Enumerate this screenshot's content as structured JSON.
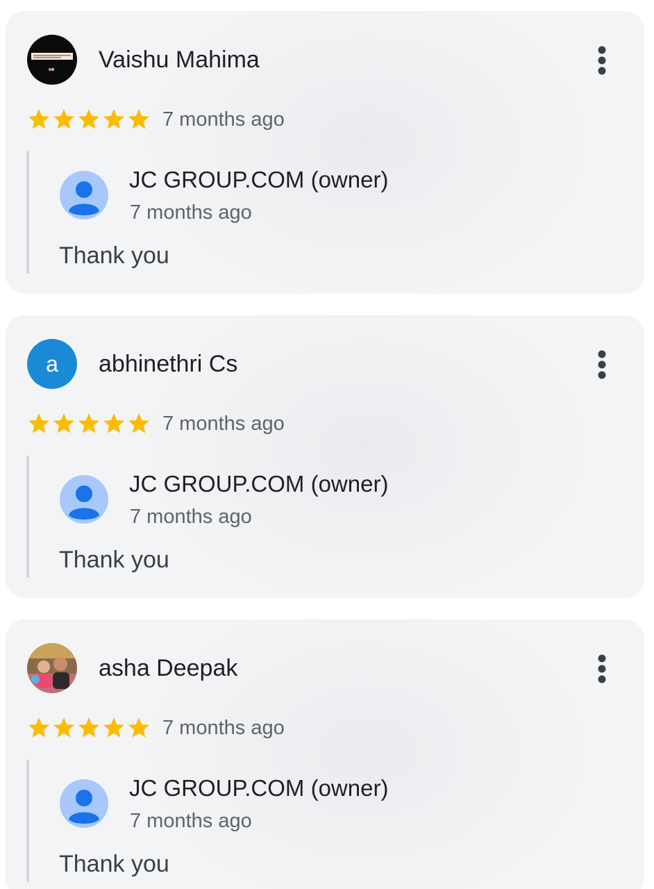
{
  "colors": {
    "star": "#fbbc04",
    "letter_avatar_bg": "#1a8ad6",
    "owner_avatar_bg": "#a8c7fa",
    "owner_avatar_fg": "#1a73e8",
    "card_bg": "#f1f3f4"
  },
  "icons": {
    "menu": "more-vert-icon",
    "star": "star-icon",
    "owner_avatar": "person-icon"
  },
  "reviews": [
    {
      "author": "Vaishu Mahima",
      "avatar_type": "image",
      "rating": 5,
      "time": "7 months ago",
      "reply": {
        "author": "JC GROUP.COM (owner)",
        "time": "7 months ago",
        "text": "Thank you"
      }
    },
    {
      "author": "abhinethri Cs",
      "avatar_type": "letter",
      "avatar_letter": "a",
      "rating": 5,
      "time": "7 months ago",
      "reply": {
        "author": "JC GROUP.COM (owner)",
        "time": "7 months ago",
        "text": "Thank you"
      }
    },
    {
      "author": "asha Deepak",
      "avatar_type": "photo",
      "rating": 5,
      "time": "7 months ago",
      "reply": {
        "author": "JC GROUP.COM (owner)",
        "time": "7 months ago",
        "text": "Thank you"
      }
    }
  ]
}
